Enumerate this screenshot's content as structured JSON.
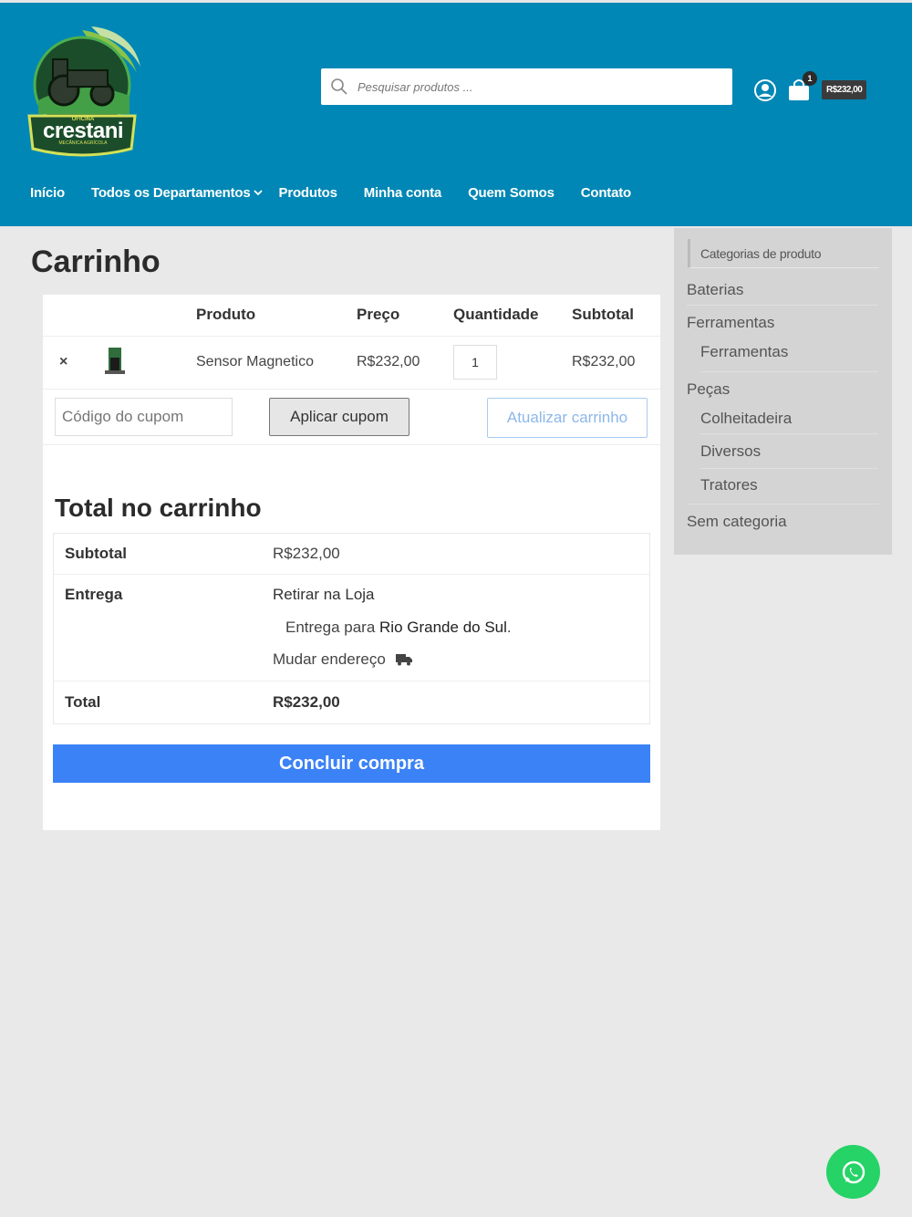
{
  "header": {
    "logo": {
      "brand": "crestani",
      "top_text": "OFICINA",
      "sub_text": "MECÂNICA AGRÍCOLA"
    },
    "search_placeholder": "Pesquisar produtos ...",
    "cart_count": "1",
    "cart_total": "R$232,00",
    "brand_color": "#0087b5"
  },
  "nav": {
    "items": [
      "Início",
      "Todos os Departamentos",
      "Produtos",
      "Minha conta",
      "Quem Somos",
      "Contato"
    ]
  },
  "page": {
    "title": "Carrinho"
  },
  "cart": {
    "headers": {
      "product": "Produto",
      "price": "Preço",
      "quantity": "Quantidade",
      "subtotal": "Subtotal"
    },
    "items": [
      {
        "remove": "×",
        "name": "Sensor Magnetico",
        "price": "R$232,00",
        "quantity": "1",
        "subtotal": "R$232,00"
      }
    ],
    "coupon_placeholder": "Código do cupom",
    "apply_coupon": "Aplicar cupom",
    "update_cart": "Atualizar carrinho"
  },
  "totals": {
    "title": "Total no carrinho",
    "subtotal_label": "Subtotal",
    "subtotal_value": "R$232,00",
    "shipping_label": "Entrega",
    "shipping_method": "Retirar na Loja",
    "shipping_dest_prefix": "Entrega para",
    "shipping_dest_state": "Rio Grande do Sul",
    "change_address": "Mudar endereço",
    "total_label": "Total",
    "total_value": "R$232,00",
    "checkout": "Concluir compra"
  },
  "sidebar": {
    "title": "Categorias de produto",
    "items": [
      {
        "label": "Baterias"
      },
      {
        "label": "Ferramentas"
      },
      {
        "label": "Ferramentas"
      },
      {
        "label": "Peças"
      },
      {
        "label": "Colheitadeira"
      },
      {
        "label": "Diversos"
      },
      {
        "label": "Tratores"
      },
      {
        "label": "Sem categoria"
      }
    ]
  }
}
